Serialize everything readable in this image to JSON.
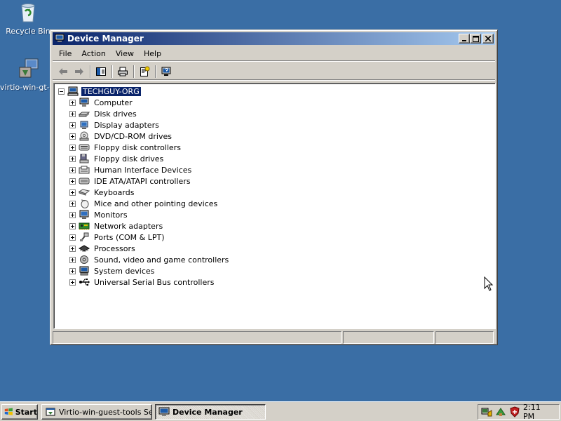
{
  "desktop": {
    "icons": [
      {
        "label": "Recycle Bin",
        "icon": "recycle-bin-icon"
      },
      {
        "label": "virtio-win-gt-...",
        "icon": "installer-icon"
      }
    ]
  },
  "window": {
    "title": "Device Manager",
    "menu": [
      "File",
      "Action",
      "View",
      "Help"
    ],
    "toolbar": [
      "back-icon",
      "forward-icon",
      "show-hide-console-tree-icon",
      "print-icon",
      "properties-icon",
      "help-icon"
    ],
    "tree": {
      "root": "TECHGUY-ORG",
      "items": [
        {
          "label": "Computer",
          "icon": "computer-icon"
        },
        {
          "label": "Disk drives",
          "icon": "disk-drive-icon"
        },
        {
          "label": "Display adapters",
          "icon": "display-adapter-icon"
        },
        {
          "label": "DVD/CD-ROM drives",
          "icon": "cdrom-icon"
        },
        {
          "label": "Floppy disk controllers",
          "icon": "floppy-controller-icon"
        },
        {
          "label": "Floppy disk drives",
          "icon": "floppy-drive-icon"
        },
        {
          "label": "Human Interface Devices",
          "icon": "hid-icon"
        },
        {
          "label": "IDE ATA/ATAPI controllers",
          "icon": "ide-controller-icon"
        },
        {
          "label": "Keyboards",
          "icon": "keyboard-icon"
        },
        {
          "label": "Mice and other pointing devices",
          "icon": "mouse-icon"
        },
        {
          "label": "Monitors",
          "icon": "monitor-icon"
        },
        {
          "label": "Network adapters",
          "icon": "network-adapter-icon"
        },
        {
          "label": "Ports (COM & LPT)",
          "icon": "port-icon"
        },
        {
          "label": "Processors",
          "icon": "processor-icon"
        },
        {
          "label": "Sound, video and game controllers",
          "icon": "sound-icon"
        },
        {
          "label": "System devices",
          "icon": "system-devices-icon"
        },
        {
          "label": "Universal Serial Bus controllers",
          "icon": "usb-icon"
        }
      ]
    }
  },
  "taskbar": {
    "start_label": "Start",
    "tasks": [
      {
        "label": "Virtio-win-guest-tools Se...",
        "active": false
      },
      {
        "label": "Device Manager",
        "active": true
      }
    ],
    "clock": "2:11 PM"
  },
  "colors": {
    "desktop": "#3A6EA5",
    "title_start": "#0A246A",
    "title_end": "#A6CAF0",
    "selection": "#0A246A",
    "chrome": "#D4D0C8"
  }
}
